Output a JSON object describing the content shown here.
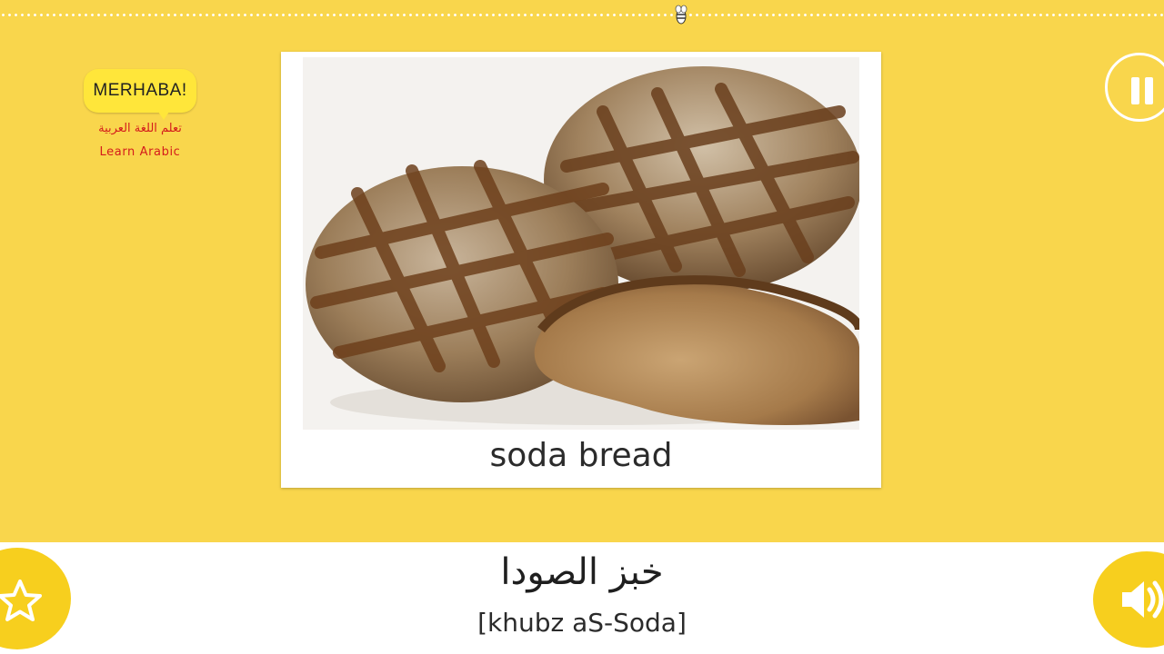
{
  "app": {
    "logo_title": "MERHABA!",
    "logo_subtitle_arabic": "تعلم اللغة العربية",
    "logo_subtitle_english": "Learn Arabic",
    "progress_fraction": 0.585
  },
  "card": {
    "caption": "soda bread",
    "image_icon": "soda-bread-photo"
  },
  "word": {
    "arabic": "خبز الصودا",
    "transliteration": "[khubz aS-Soda]"
  },
  "controls": {
    "pause_icon": "pause-icon",
    "favorite_icon": "star-icon",
    "sound_icon": "speaker-icon"
  },
  "colors": {
    "background": "#f9d64c",
    "accent": "#f7cf1e",
    "logo_text_red": "#d41c1c"
  }
}
